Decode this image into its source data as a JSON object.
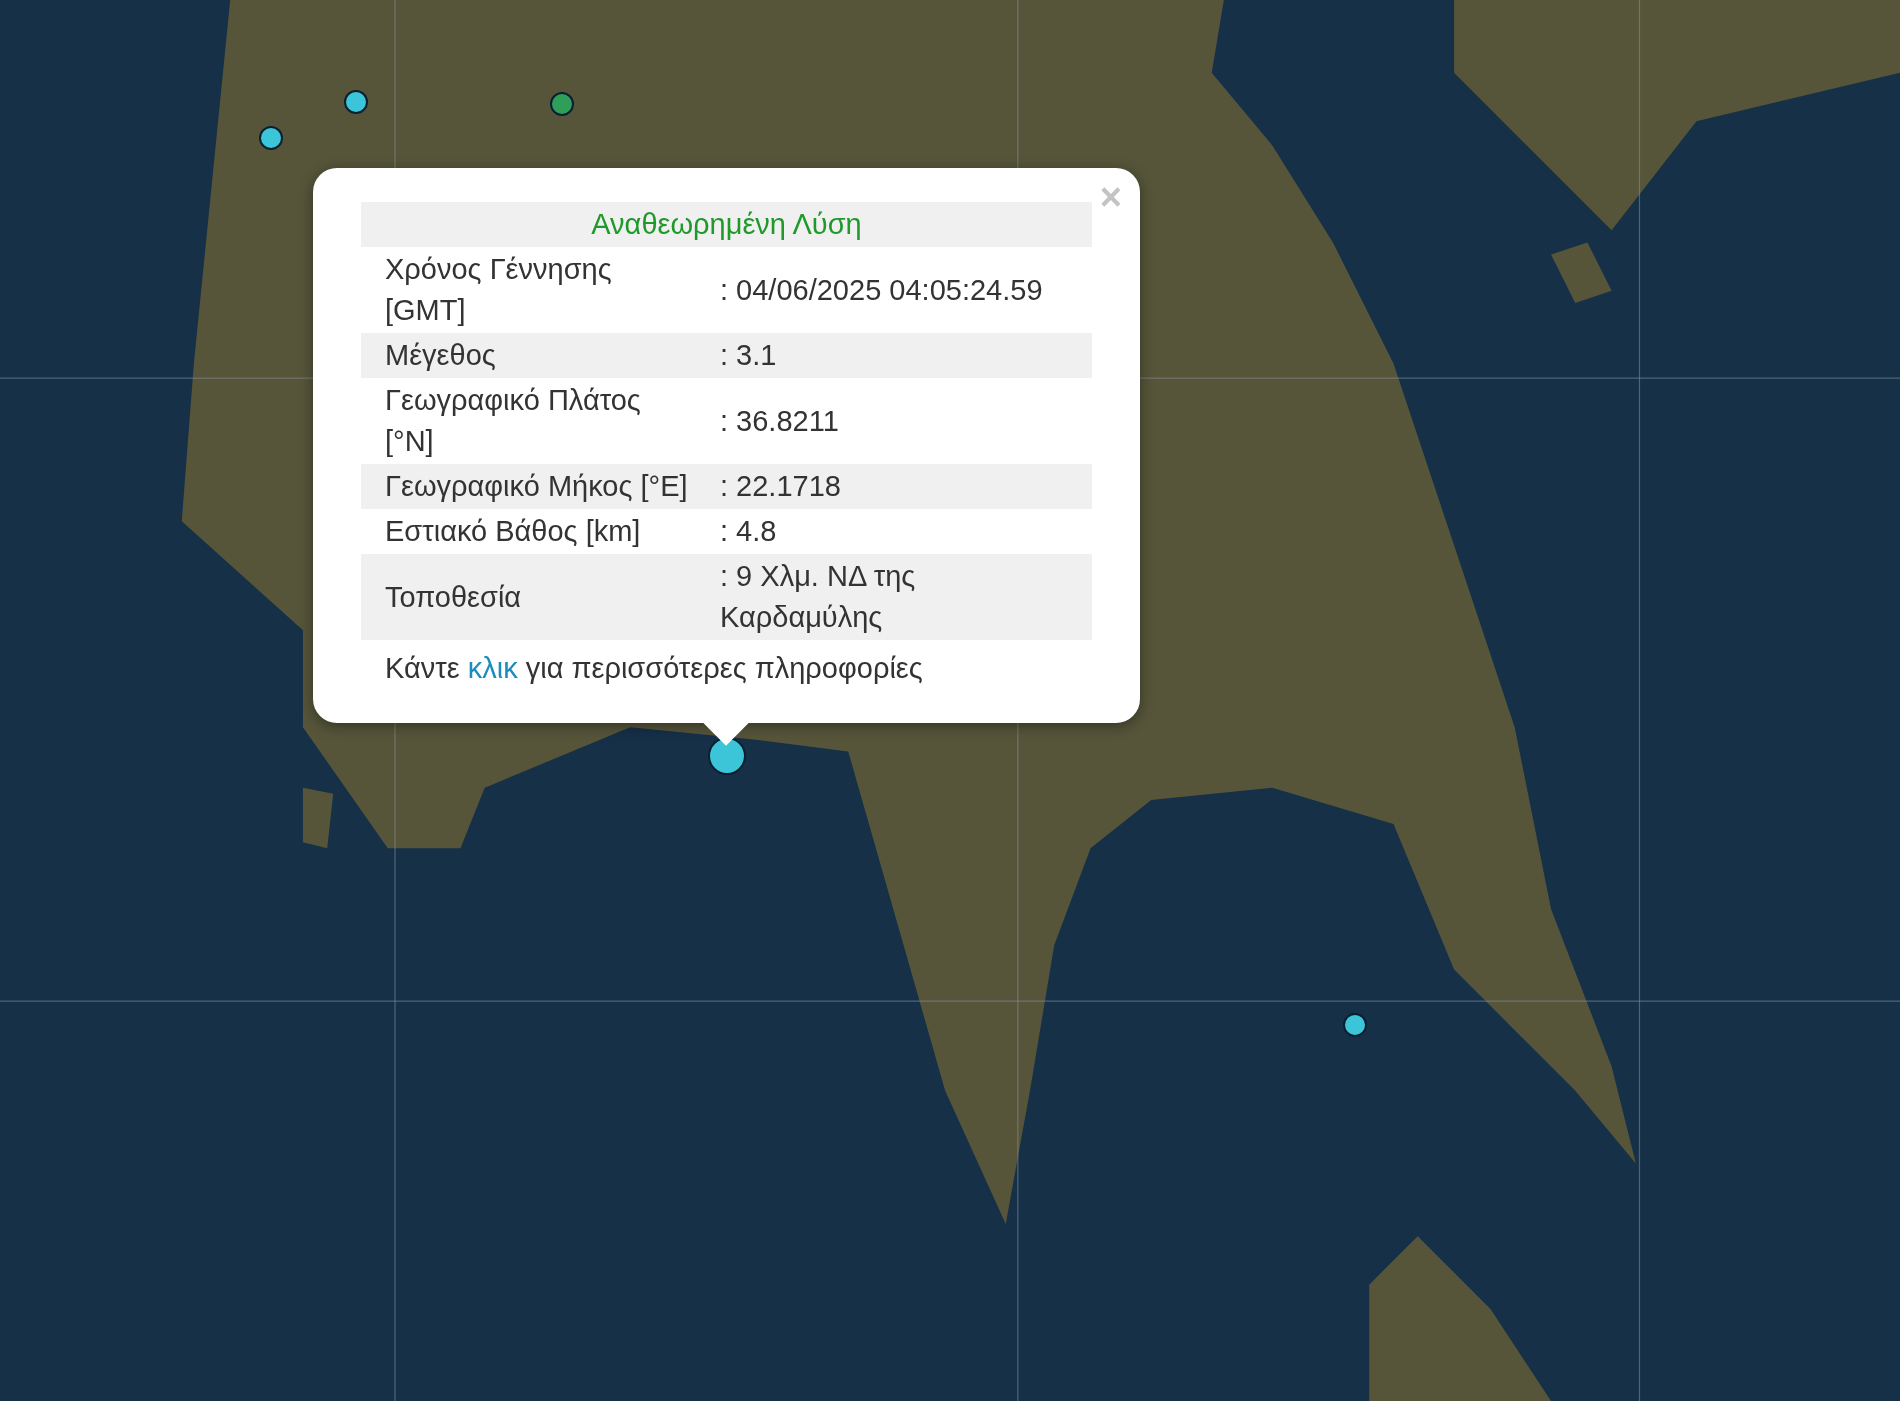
{
  "map": {
    "markers": [
      {
        "color": "#3cc4d8",
        "selected": false
      },
      {
        "color": "#3cc4d8",
        "selected": false
      },
      {
        "color": "#2e9e58",
        "selected": false
      },
      {
        "color": "#3cc4d8",
        "selected": true
      },
      {
        "color": "#3cc4d8",
        "selected": false
      }
    ]
  },
  "popup": {
    "close": "×",
    "title": "Αναθεωρημένη Λύση",
    "rows": [
      {
        "label": "Χρόνος Γέννησης [GMT]",
        "value": ": 04/06/2025 04:05:24.59"
      },
      {
        "label": "Μέγεθος",
        "value": ": 3.1"
      },
      {
        "label": "Γεωγραφικό Πλάτος [°N]",
        "value": ": 36.8211"
      },
      {
        "label": "Γεωγραφικό Μήκος [°E]",
        "value": ": 22.1718"
      },
      {
        "label": "Εστιακό Βάθος [km]",
        "value": ": 4.8"
      },
      {
        "label": "Τοποθεσία",
        "value": ": 9 Χλμ. ΝΔ της Καρδαμύλης"
      }
    ],
    "footer": {
      "before": "Κάντε ",
      "link": "κλικ",
      "after": " για περισσότερες πληροφορίες"
    }
  }
}
